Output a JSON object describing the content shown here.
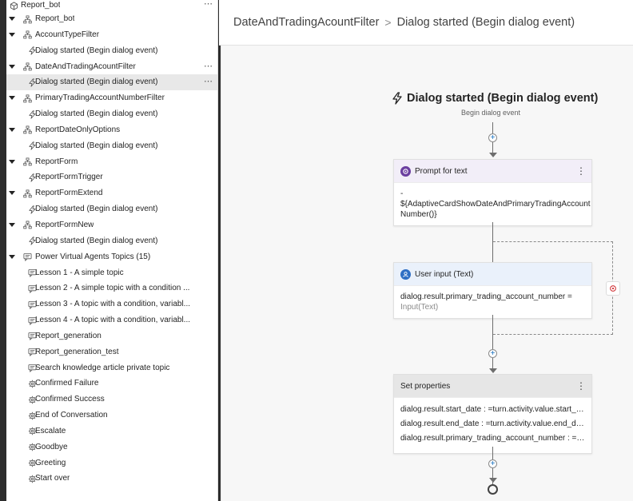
{
  "tree": [
    {
      "label": "Report_bot",
      "icon": "bot-icon",
      "caret": false,
      "level": 0,
      "more": true
    },
    {
      "label": "Report_bot",
      "icon": "topic-tree-icon",
      "caret": true,
      "level": 1,
      "more": false
    },
    {
      "label": "AccountTypeFilter",
      "icon": "topic-tree-icon",
      "caret": true,
      "level": 1,
      "more": false
    },
    {
      "label": "Dialog started (Begin dialog event)",
      "icon": "lightning-icon",
      "caret": false,
      "level": 2,
      "more": false
    },
    {
      "label": "DateAndTradingAcountFilter",
      "icon": "topic-tree-icon",
      "caret": true,
      "level": 1,
      "more": true
    },
    {
      "label": "Dialog started (Begin dialog event)",
      "icon": "lightning-icon",
      "caret": false,
      "level": 2,
      "more": true,
      "selected": true
    },
    {
      "label": "PrimaryTradingAccountNumberFilter",
      "icon": "topic-tree-icon",
      "caret": true,
      "level": 1,
      "more": false
    },
    {
      "label": "Dialog started (Begin dialog event)",
      "icon": "lightning-icon",
      "caret": false,
      "level": 2,
      "more": false
    },
    {
      "label": "ReportDateOnlyOptions",
      "icon": "topic-tree-icon",
      "caret": true,
      "level": 1,
      "more": false
    },
    {
      "label": "Dialog started (Begin dialog event)",
      "icon": "lightning-icon",
      "caret": false,
      "level": 2,
      "more": false
    },
    {
      "label": "ReportForm",
      "icon": "topic-tree-icon",
      "caret": true,
      "level": 1,
      "more": false
    },
    {
      "label": "ReportFormTrigger",
      "icon": "lightning-icon",
      "caret": false,
      "level": 2,
      "more": false
    },
    {
      "label": "ReportFormExtend",
      "icon": "topic-tree-icon",
      "caret": true,
      "level": 1,
      "more": false
    },
    {
      "label": "Dialog started (Begin dialog event)",
      "icon": "lightning-icon",
      "caret": false,
      "level": 2,
      "more": false
    },
    {
      "label": "ReportFormNew",
      "icon": "topic-tree-icon",
      "caret": true,
      "level": 1,
      "more": false
    },
    {
      "label": "Dialog started (Begin dialog event)",
      "icon": "lightning-icon",
      "caret": false,
      "level": 2,
      "more": false
    },
    {
      "label": "Power Virtual Agents Topics (15)",
      "icon": "chat-icon",
      "caret": true,
      "level": 1,
      "more": false
    },
    {
      "label": "Lesson 1 - A simple topic",
      "icon": "chat-icon",
      "caret": false,
      "level": 2,
      "more": false
    },
    {
      "label": "Lesson 2 - A simple topic with a condition ...",
      "icon": "chat-icon",
      "caret": false,
      "level": 2,
      "more": false
    },
    {
      "label": "Lesson 3 - A topic with a condition, variabl...",
      "icon": "chat-icon",
      "caret": false,
      "level": 2,
      "more": false
    },
    {
      "label": "Lesson 4 - A topic with a condition, variabl...",
      "icon": "chat-icon",
      "caret": false,
      "level": 2,
      "more": false
    },
    {
      "label": "Report_generation",
      "icon": "chat-icon",
      "caret": false,
      "level": 2,
      "more": false
    },
    {
      "label": "Report_generation_test",
      "icon": "chat-icon",
      "caret": false,
      "level": 2,
      "more": false
    },
    {
      "label": "Search knowledge article private topic",
      "icon": "chat-icon",
      "caret": false,
      "level": 2,
      "more": false
    },
    {
      "label": "Confirmed Failure",
      "icon": "system-topic-icon",
      "caret": false,
      "level": 2,
      "more": false
    },
    {
      "label": "Confirmed Success",
      "icon": "system-topic-icon",
      "caret": false,
      "level": 2,
      "more": false
    },
    {
      "label": "End of Conversation",
      "icon": "system-topic-icon",
      "caret": false,
      "level": 2,
      "more": false
    },
    {
      "label": "Escalate",
      "icon": "system-topic-icon",
      "caret": false,
      "level": 2,
      "more": false
    },
    {
      "label": "Goodbye",
      "icon": "system-topic-icon",
      "caret": false,
      "level": 2,
      "more": false
    },
    {
      "label": "Greeting",
      "icon": "system-topic-icon",
      "caret": false,
      "level": 2,
      "more": false
    },
    {
      "label": "Start over",
      "icon": "system-topic-icon",
      "caret": false,
      "level": 2,
      "more": false
    }
  ],
  "header": {
    "crumb_parent": "DateAndTradingAcountFilter",
    "separator": ">",
    "crumb_current": "Dialog started (Begin dialog event)"
  },
  "canvas": {
    "trigger_title": "Dialog started (Begin dialog event)",
    "trigger_subtitle": "Begin dialog event",
    "prompt_node": {
      "title": "Prompt for text",
      "body_line1": "-",
      "body_line2": "${AdaptiveCardShowDateAndPrimaryTradingAccount",
      "body_line3": "Number()}"
    },
    "input_node": {
      "title": "User input (Text)",
      "body_line1": "dialog.result.primary_trading_account_number =",
      "body_line2": "Input(Text)"
    },
    "set_node": {
      "title": "Set properties",
      "props": [
        "dialog.result.start_date : =turn.activity.value.start_date",
        "dialog.result.end_date : =turn.activity.value.end_date",
        "dialog.result.primary_trading_account_number : =tu..."
      ]
    },
    "plus_label": "+"
  },
  "colors": {
    "prompt_icon": "#6b3fa0",
    "input_icon": "#2f6fc4",
    "prompt_header_bg": "#f2eef8",
    "input_header_bg": "#eaf1fb",
    "set_header_bg": "#e6e6e6",
    "redo_icon": "#d13438"
  }
}
